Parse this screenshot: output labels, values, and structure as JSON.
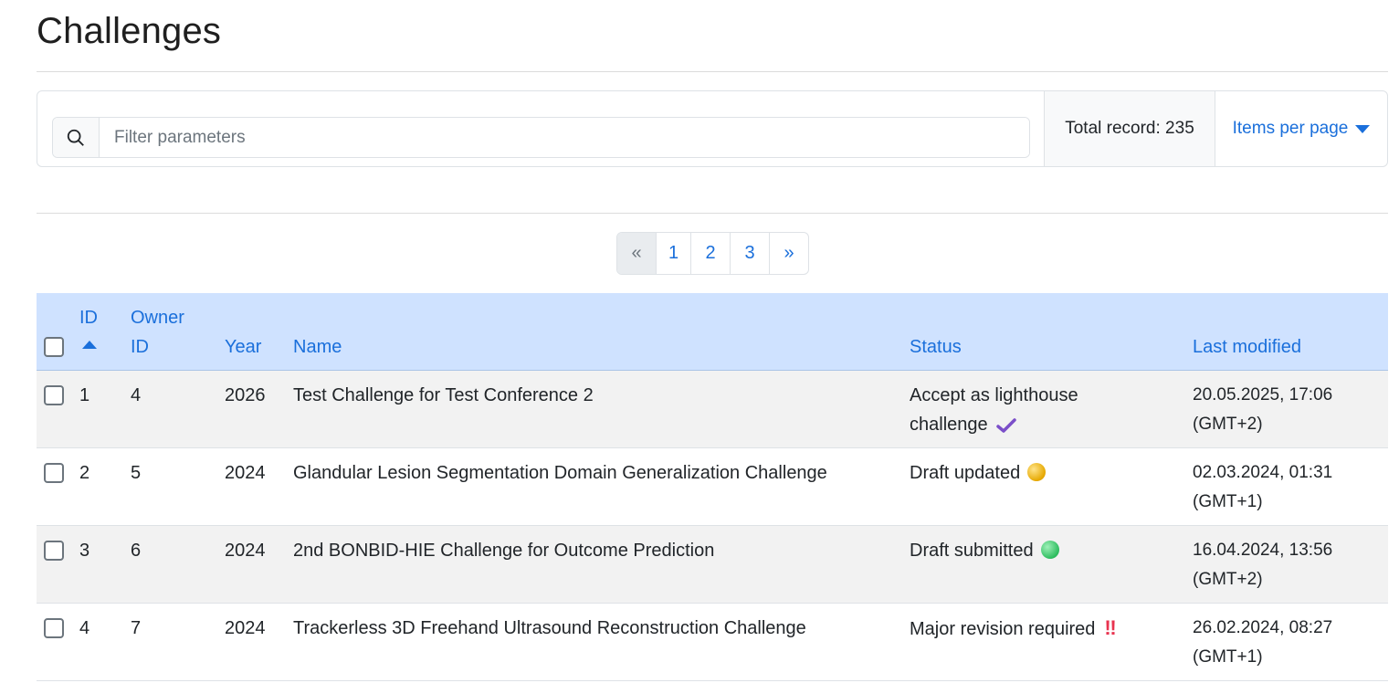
{
  "page": {
    "title": "Challenges"
  },
  "filter": {
    "placeholder": "Filter parameters",
    "total_label": "Total record: 235",
    "items_per_page": "Items per page"
  },
  "pagination": {
    "prev": "«",
    "pages": [
      "1",
      "2",
      "3"
    ],
    "next": "»"
  },
  "table": {
    "headers": {
      "id": "ID",
      "owner_id_line1": "Owner",
      "owner_id_line2": "ID",
      "year": "Year",
      "name": "Name",
      "status": "Status",
      "last_modified": "Last modified"
    },
    "rows": [
      {
        "id": "1",
        "owner_id": "4",
        "year": "2026",
        "name": "Test Challenge for Test Conference 2",
        "status_line1": "Accept as lighthouse",
        "status_line2": "challenge",
        "status_icon": "purple-check-icon",
        "modified_date": "20.05.2025, 17:06",
        "modified_tz": "(GMT+2)"
      },
      {
        "id": "2",
        "owner_id": "5",
        "year": "2024",
        "name": "Glandular Lesion Segmentation Domain Generalization Challenge",
        "status": "Draft updated",
        "status_icon": "yellow-dot-icon",
        "modified_date": "02.03.2024, 01:31",
        "modified_tz": "(GMT+1)"
      },
      {
        "id": "3",
        "owner_id": "6",
        "year": "2024",
        "name": "2nd BONBID-HIE Challenge for Outcome Prediction",
        "status": "Draft submitted",
        "status_icon": "green-dot-icon",
        "modified_date": "16.04.2024, 13:56",
        "modified_tz": "(GMT+2)"
      },
      {
        "id": "4",
        "owner_id": "7",
        "year": "2024",
        "name": "Trackerless 3D Freehand Ultrasound Reconstruction Challenge",
        "status": "Major revision required",
        "status_icon": "double-exclamation-icon",
        "status_mark": "‼",
        "modified_date": "26.02.2024, 08:27",
        "modified_tz": "(GMT+1)"
      }
    ]
  },
  "colors": {
    "accent": "#1a6fdb",
    "header_bg": "#cfe2ff",
    "alt_row_bg": "#f2f2f2",
    "check_purple": "#7b4fc9"
  }
}
